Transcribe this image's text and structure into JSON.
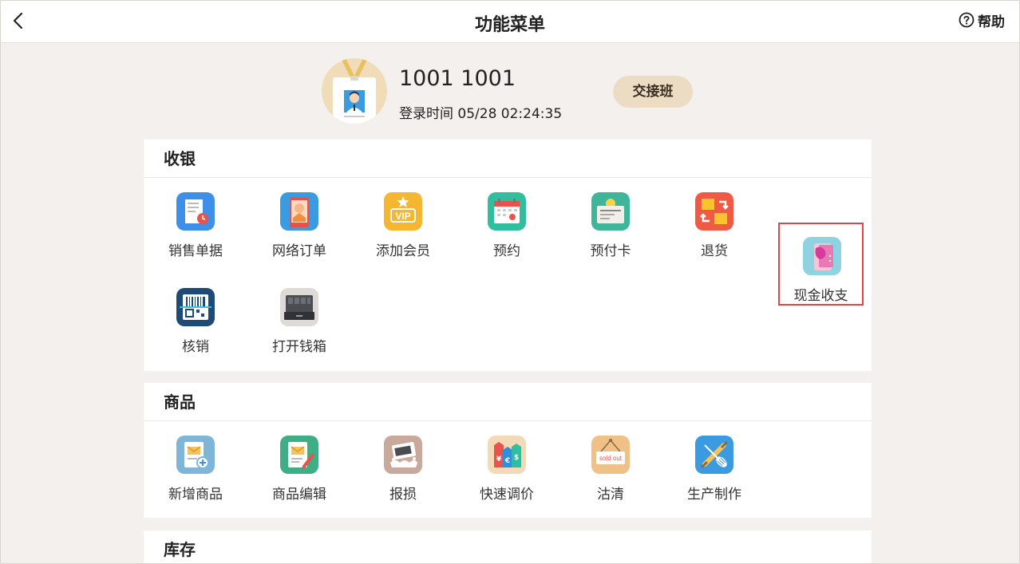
{
  "header": {
    "title": "功能菜单",
    "help_label": "帮助"
  },
  "profile": {
    "user_name": "1001 1001",
    "login_time": "登录时间 05/28 02:24:35",
    "shift_button": "交接班"
  },
  "sections": {
    "cashier": {
      "title": "收银",
      "items": [
        {
          "label": "销售单据",
          "icon": "sales-receipt-icon"
        },
        {
          "label": "网络订单",
          "icon": "online-order-icon"
        },
        {
          "label": "添加会员",
          "icon": "vip-member-icon"
        },
        {
          "label": "预约",
          "icon": "calendar-icon"
        },
        {
          "label": "预付卡",
          "icon": "prepaid-card-icon"
        },
        {
          "label": "退货",
          "icon": "return-goods-icon"
        },
        {
          "label": "现金收支",
          "icon": "cash-payment-icon"
        },
        {
          "label": "核销",
          "icon": "barcode-scan-icon"
        },
        {
          "label": "打开钱箱",
          "icon": "cash-drawer-icon"
        }
      ]
    },
    "goods": {
      "title": "商品",
      "items": [
        {
          "label": "新增商品",
          "icon": "add-product-icon"
        },
        {
          "label": "商品编辑",
          "icon": "edit-product-icon"
        },
        {
          "label": "报损",
          "icon": "damage-report-icon"
        },
        {
          "label": "快速调价",
          "icon": "price-tag-icon"
        },
        {
          "label": "沽清",
          "icon": "sold-out-icon"
        },
        {
          "label": "生产制作",
          "icon": "production-tools-icon"
        }
      ],
      "sold_out_text": "sold out"
    },
    "inventory": {
      "title": "库存"
    }
  },
  "icon_text": {
    "vip": "VIP",
    "currency": [
      "¥",
      "€",
      "$"
    ]
  },
  "colors": {
    "highlight": "#e04646",
    "shift_button_bg": "#ecdcc3",
    "page_bg": "#f4f0ee"
  }
}
